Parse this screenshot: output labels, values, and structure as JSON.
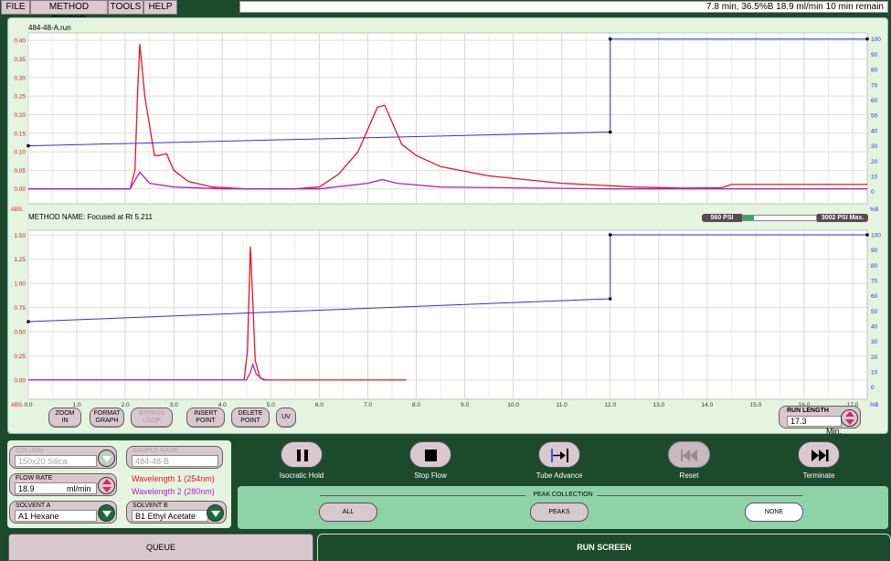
{
  "menu": [
    "FILE",
    "METHOD EDITOR",
    "TOOLS",
    "HELP"
  ],
  "status": "7.8 min, 36.5%B 18.9 ml/min 10 min remain",
  "graph_buttons": [
    {
      "l1": "ZOOM",
      "l2": "IN",
      "enabled": true
    },
    {
      "l1": "FORMAT",
      "l2": "GRAPH",
      "enabled": true
    },
    {
      "l1": "BYPASS",
      "l2": "LOOP",
      "enabled": false
    },
    {
      "l1": "INSERT",
      "l2": "POINT",
      "enabled": true
    },
    {
      "l1": "DELETE",
      "l2": "POINT",
      "enabled": true
    },
    {
      "l1": "UV",
      "l2": "",
      "enabled": true
    }
  ],
  "run_length": {
    "label": "RUN LENGTH",
    "value": "17.3",
    "unit": "Min."
  },
  "pressure": {
    "min_label": "560 PSI",
    "max_label": "3002 PSI Max.",
    "fill_fraction": 0.15
  },
  "params": {
    "column": {
      "label": "COLUMN",
      "value": "150x20 Silica"
    },
    "sample_name": {
      "label": "SAMPLE NAME",
      "value": "484-48-B"
    },
    "flow_rate": {
      "label": "FLOW RATE",
      "value": "18.9",
      "unit": "ml/min"
    },
    "wavelength1": "Wavelength 1 (254nm)",
    "wavelength2": "Wavelength 2 (280nm)",
    "solvent_a": {
      "label": "SOLVENT A",
      "value": "A1 Hexane"
    },
    "solvent_b": {
      "label": "SOLVENT B",
      "value": "B1 Ethyl Acetate"
    }
  },
  "controls": [
    {
      "label": "Isocratic Hold",
      "icon": "pause-icon",
      "enabled": true
    },
    {
      "label": "Stop Flow",
      "icon": "stop-icon",
      "enabled": true
    },
    {
      "label": "Tube Advance",
      "icon": "tube-advance-icon",
      "enabled": true
    },
    {
      "label": "Reset",
      "icon": "rewind-icon",
      "enabled": false
    },
    {
      "label": "Terminate",
      "icon": "skip-forward-icon",
      "enabled": true
    }
  ],
  "peak_collection": {
    "title": "PEAK COLLECTION",
    "options": [
      "ALL",
      "PEAKS",
      "NONE"
    ],
    "selected": "NONE"
  },
  "tabs": {
    "queue": "QUEUE",
    "run": "RUN SCREEN"
  },
  "colors": {
    "uv254": "#e8141e",
    "uv280": "#b020c8",
    "gradient": "#3030e0",
    "background": "#1c4a2c",
    "panel": "#e4f4e0"
  },
  "chart_data": [
    {
      "type": "line",
      "title": "484-48-A.run",
      "ylabel": "ABS.",
      "y2label": "%B",
      "ylim": [
        -0.04,
        0.42
      ],
      "yticks": [
        "0.00",
        "0.05",
        "0.10",
        "0.15",
        "0.20",
        "0.25",
        "0.30",
        "0.35",
        "0.40"
      ],
      "y2lim": [
        -8,
        104
      ],
      "y2ticks": [
        "0",
        "10",
        "20",
        "30",
        "40",
        "50",
        "60",
        "70",
        "80",
        "90",
        "100"
      ],
      "xlim": [
        0,
        17.3
      ],
      "series": [
        {
          "color": "#e8141e",
          "x": [
            0,
            2.1,
            2.2,
            2.25,
            2.3,
            2.4,
            2.6,
            2.7,
            2.85,
            3.0,
            3.3,
            3.8,
            4.5,
            5.5,
            6.0,
            6.4,
            6.8,
            7.0,
            7.2,
            7.35,
            7.5,
            7.7,
            8.0,
            8.5,
            9.5,
            11.0,
            12.5,
            13.5,
            14.3,
            14.5,
            17.3
          ],
          "y": [
            0.0,
            0.0,
            0.05,
            0.25,
            0.39,
            0.25,
            0.09,
            0.09,
            0.095,
            0.05,
            0.02,
            0.005,
            0.0,
            0.0,
            0.005,
            0.04,
            0.1,
            0.16,
            0.22,
            0.225,
            0.18,
            0.12,
            0.09,
            0.06,
            0.035,
            0.015,
            0.005,
            0.002,
            0.003,
            0.012,
            0.012
          ]
        },
        {
          "color": "#b020c8",
          "x": [
            0,
            2.1,
            2.3,
            2.5,
            3.0,
            4.0,
            6.0,
            7.0,
            7.3,
            7.6,
            8.5,
            12.0,
            17.3
          ],
          "y": [
            0.0,
            0.0,
            0.045,
            0.015,
            0.005,
            0.0,
            0.0,
            0.015,
            0.025,
            0.015,
            0.005,
            0.0,
            0.0
          ]
        },
        {
          "color": "#3030e0",
          "axis": "right",
          "x": [
            0,
            12.0,
            12.0,
            17.3
          ],
          "y": [
            30,
            39,
            100,
            100
          ],
          "markers": [
            0,
            12.0,
            12.0,
            17.3
          ]
        }
      ]
    },
    {
      "type": "line",
      "title": "METHOD NAME: Focused at Rt 5.211",
      "ylabel": "ABS.",
      "y2label": "%B",
      "ylim": [
        -0.2,
        1.55
      ],
      "yticks": [
        "0.00",
        "0.25",
        "0.50",
        "0.75",
        "1.00",
        "1.25",
        "1.50"
      ],
      "y2lim": [
        -8,
        103
      ],
      "y2ticks": [
        "0",
        "10",
        "20",
        "30",
        "40",
        "50",
        "60",
        "70",
        "80",
        "90",
        "100"
      ],
      "xlim": [
        0,
        17.3
      ],
      "xticks": [
        "0.0",
        "1.0",
        "2.0",
        "3.0",
        "4.0",
        "5.0",
        "6.0",
        "7.0",
        "8.0",
        "9.0",
        "10.0",
        "11.0",
        "12.0",
        "13.0",
        "14.0",
        "15.0",
        "16.0",
        "17.0"
      ],
      "series": [
        {
          "color": "#e8141e",
          "x": [
            0,
            4.45,
            4.52,
            4.58,
            4.63,
            4.68,
            4.78,
            4.9,
            7.8
          ],
          "y": [
            0.0,
            0.0,
            0.3,
            1.38,
            0.8,
            0.2,
            0.02,
            0.0,
            0.0
          ]
        },
        {
          "color": "#b020c8",
          "x": [
            0,
            4.5,
            4.58,
            4.63,
            4.7,
            4.85,
            5.0
          ],
          "y": [
            0.0,
            0.0,
            0.08,
            0.16,
            0.06,
            0.0,
            0.0
          ]
        },
        {
          "color": "#3030e0",
          "axis": "right",
          "x": [
            0,
            12.0,
            12.0,
            17.3
          ],
          "y": [
            43,
            58,
            100,
            100
          ],
          "markers": [
            0,
            12.0,
            12.0,
            17.3
          ]
        }
      ]
    }
  ]
}
